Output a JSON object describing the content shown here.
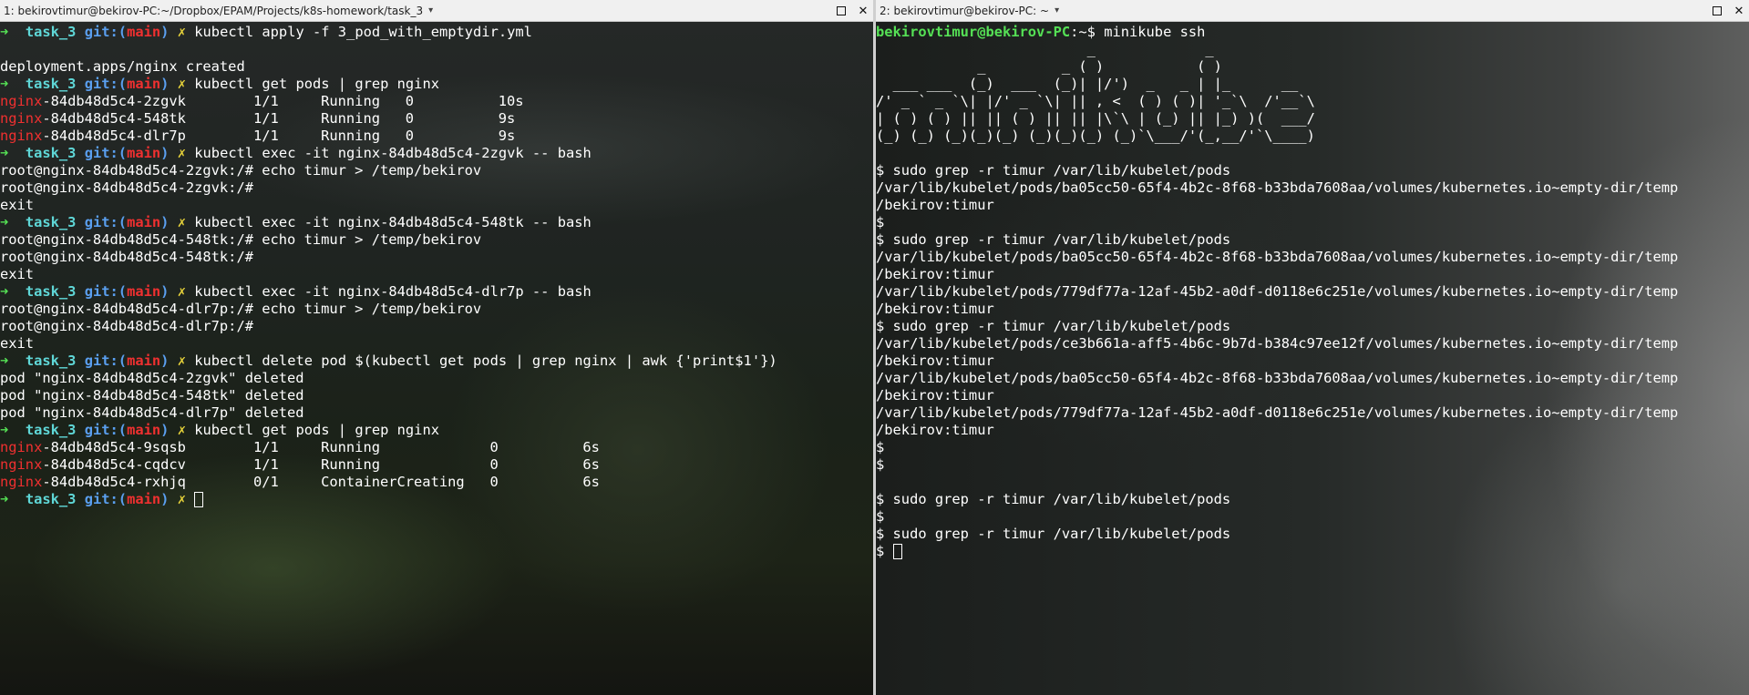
{
  "left": {
    "title": "1: bekirovtimur@bekirov-PC:~/Dropbox/EPAM/Projects/k8s-homework/task_3",
    "prompt": {
      "arrow": "➜",
      "dir": "task_3",
      "git_open": "git:(",
      "branch": "main",
      "git_close": ")",
      "dirty": "✗"
    },
    "commands": {
      "c1": "kubectl apply -f 3_pod_with_emptydir.yml",
      "c2": "kubectl get pods | grep nginx",
      "c3": "kubectl exec -it nginx-84db48d5c4-2zgvk -- bash",
      "c4": "kubectl exec -it nginx-84db48d5c4-548tk -- bash",
      "c5": "kubectl exec -it nginx-84db48d5c4-dlr7p -- bash",
      "c6": "kubectl delete pod $(kubectl get pods | grep nginx | awk {'print$1'})",
      "c7": "kubectl get pods | grep nginx"
    },
    "outputs": {
      "created": "deployment.apps/nginx created",
      "exit": "exit",
      "del1": "pod \"nginx-84db48d5c4-2zgvk\" deleted",
      "del2": "pod \"nginx-84db48d5c4-548tk\" deleted",
      "del3": "pod \"nginx-84db48d5c4-dlr7p\" deleted"
    },
    "pods1": [
      {
        "name_hi": "nginx",
        "name_rest": "-84db48d5c4-2zgvk        1/1     Running   0          10s"
      },
      {
        "name_hi": "nginx",
        "name_rest": "-84db48d5c4-548tk        1/1     Running   0          9s"
      },
      {
        "name_hi": "nginx",
        "name_rest": "-84db48d5c4-dlr7p        1/1     Running   0          9s"
      }
    ],
    "pods2": [
      {
        "name_hi": "nginx",
        "name_rest": "-84db48d5c4-9sqsb        1/1     Running             0          6s"
      },
      {
        "name_hi": "nginx",
        "name_rest": "-84db48d5c4-cqdcv        1/1     Running             0          6s"
      },
      {
        "name_hi": "nginx",
        "name_rest": "-84db48d5c4-rxhjq        0/1     ContainerCreating   0          6s"
      }
    ],
    "shell": {
      "p1": "root@nginx-84db48d5c4-2zgvk:/# echo timur > /temp/bekirov",
      "p1b": "root@nginx-84db48d5c4-2zgvk:/#",
      "p2": "root@nginx-84db48d5c4-548tk:/# echo timur > /temp/bekirov",
      "p2b": "root@nginx-84db48d5c4-548tk:/#",
      "p3": "root@nginx-84db48d5c4-dlr7p:/# echo timur > /temp/bekirov",
      "p3b": "root@nginx-84db48d5c4-dlr7p:/#"
    }
  },
  "right": {
    "title": "2: bekirovtimur@bekirov-PC: ~",
    "prompt_user": "bekirovtimur@bekirov-PC",
    "prompt_path": ":~$ ",
    "cmd_ssh": "minikube ssh",
    "banner": [
      "                         _             _",
      "            _         _ ( )           ( )",
      "  ___ ___  (_)  ___  (_)| |/')  _   _ | |_      __",
      "/' _ ` _ `\\| |/' _ `\\| || , <  ( ) ( )| '_`\\  /'__`\\",
      "| ( ) ( ) || || ( ) || || |\\`\\ | (_) || |_) )(  ___/",
      "(_) (_) (_)(_)(_) (_)(_)(_) (_)`\\___/'(_,__/'`\\____)"
    ],
    "sh": "$",
    "grep_cmd": "$ sudo grep -r timur /var/lib/kubelet/pods",
    "res_a1": "/var/lib/kubelet/pods/ba05cc50-65f4-4b2c-8f68-b33bda7608aa/volumes/kubernetes.io~empty-dir/temp",
    "res_b1": "/var/lib/kubelet/pods/779df77a-12af-45b2-a0df-d0118e6c251e/volumes/kubernetes.io~empty-dir/temp",
    "res_c1": "/var/lib/kubelet/pods/ce3b661a-aff5-4b6c-9b7d-b384c97ee12f/volumes/kubernetes.io~empty-dir/temp",
    "res_tail": "/bekirov:timur",
    "last_prompt": "$ "
  }
}
